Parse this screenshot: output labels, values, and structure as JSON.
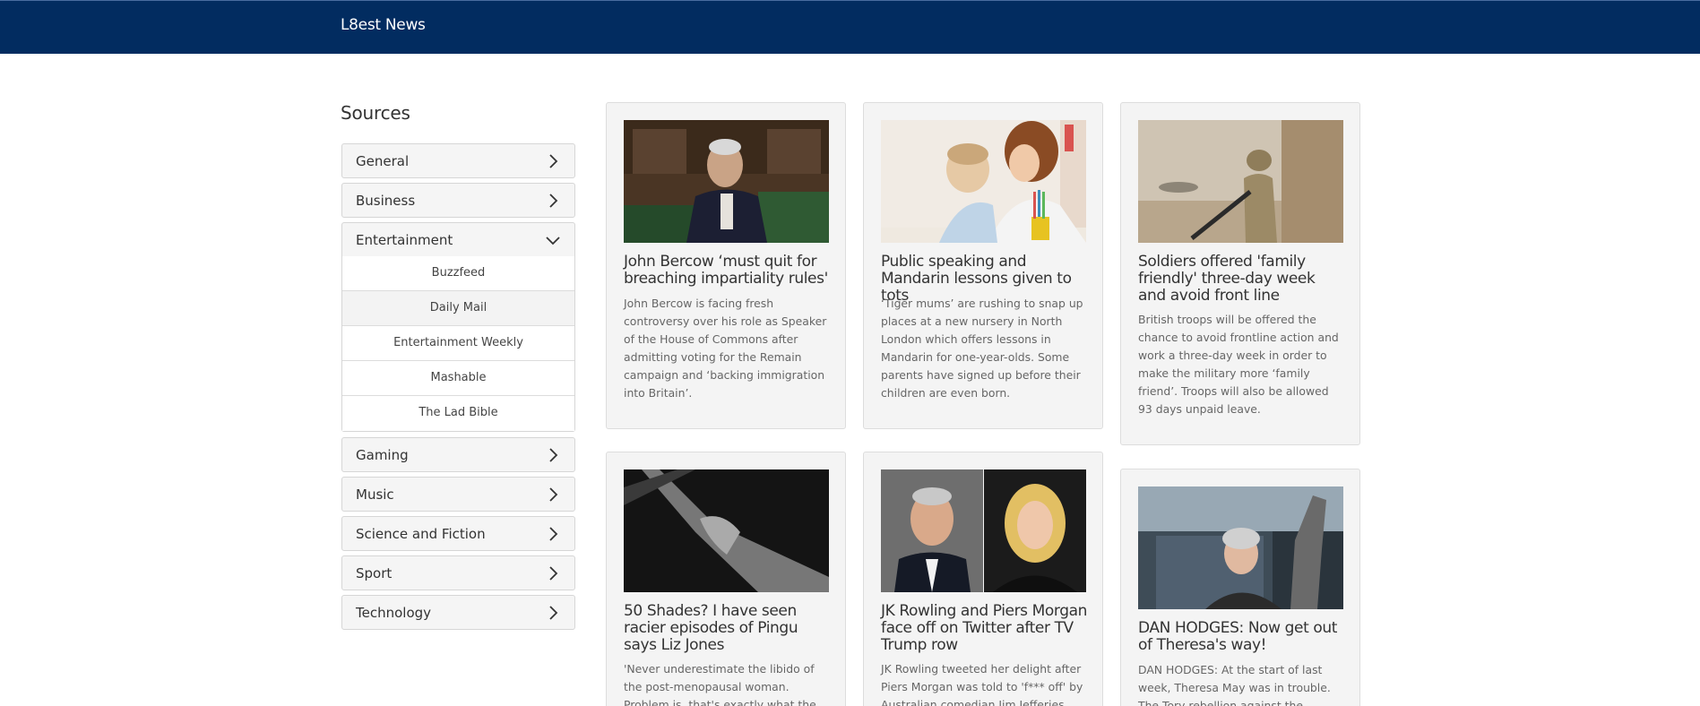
{
  "header": {
    "brand": "L8est News"
  },
  "sidebar": {
    "title": "Sources",
    "categories": [
      {
        "label": "General"
      },
      {
        "label": "Business"
      },
      {
        "label": "Entertainment",
        "expanded": true,
        "sources": [
          "Buzzfeed",
          "Daily Mail",
          "Entertainment Weekly",
          "Mashable",
          "The Lad Bible"
        ]
      },
      {
        "label": "Gaming"
      },
      {
        "label": "Music"
      },
      {
        "label": "Science and Fiction"
      },
      {
        "label": "Sport"
      },
      {
        "label": "Technology"
      }
    ]
  },
  "articles": [
    {
      "title": "John Bercow ‘must quit for breaching impartiality rules'",
      "description": "John Bercow is facing fresh controversy over his role as Speaker of the House of Commons after admitting voting for the Remain campaign and ‘backing immigration into Britain’."
    },
    {
      "title": "Public speaking and Mandarin lessons given to tots",
      "description": "‘Tiger mums’ are rushing to snap up places at a new nursery in North London which offers lessons in Mandarin for one-year-olds. Some parents have signed up before their children are even born."
    },
    {
      "title": "Soldiers offered 'family friendly' three-day week and avoid front line",
      "description": "British troops will be offered the chance to avoid frontline action and work a three-day week in order to make the military more ‘family friend’. Troops will also be allowed 93 days unpaid leave."
    },
    {
      "title": "50 Shades? I have seen racier episodes of Pingu says Liz Jones",
      "description": "'Never underestimate the libido of the post-menopausal woman. Problem is, that's exactly what the filmmakers..."
    },
    {
      "title": "JK Rowling and Piers Morgan face off on Twitter after TV Trump row",
      "description": "JK Rowling tweeted her delight after Piers Morgan was told to 'f*** off' by Australian comedian Jim Jefferies..."
    },
    {
      "title": "DAN HODGES: Now get out of Theresa's way!",
      "description": "DAN HODGES: At the start of last week, Theresa May was in trouble. The Tory rebellion against the triggering of..."
    }
  ]
}
